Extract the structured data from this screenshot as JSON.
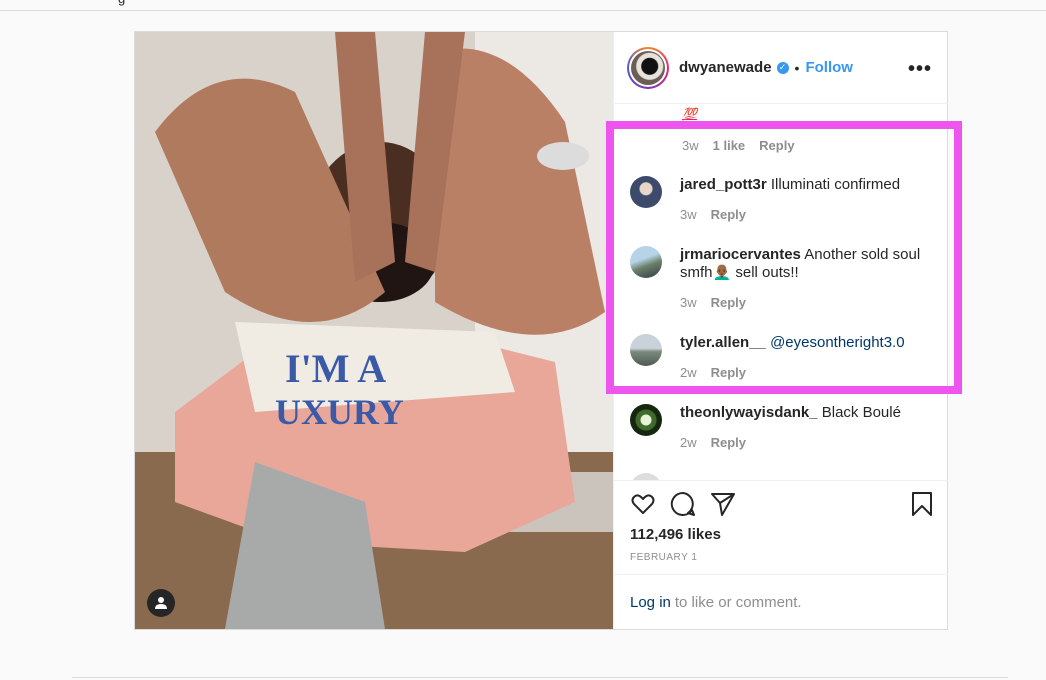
{
  "top_fragment": "g",
  "post": {
    "username": "dwyanewade",
    "verified_mark": "✓",
    "separator": "•",
    "follow_label": "Follow",
    "more_label": "•••",
    "emoji_line": "💯",
    "first_meta": {
      "time": "3w",
      "likes": "1 like",
      "reply": "Reply"
    },
    "comments": [
      {
        "user": "jared_pott3r",
        "text": "Illuminati confirmed",
        "time": "3w",
        "reply": "Reply"
      },
      {
        "user": "jrmariocervantes",
        "text": "Another sold soul smfh👨🏾‍🦲 sell outs!!",
        "time": "3w",
        "reply": "Reply"
      },
      {
        "user": "tyler.allen__",
        "text": "@eyesontheright3.0",
        "time": "2w",
        "reply": "Reply"
      },
      {
        "user": "theonlywayisdank_",
        "text": "Black Boulé",
        "time": "2w",
        "reply": "Reply"
      }
    ],
    "likes_count": "112,496 likes",
    "date": "FEBRUARY 1",
    "login_link": "Log in",
    "login_text": "to like or comment."
  },
  "icons": {
    "like": "heart-icon",
    "comment": "comment-icon",
    "share": "paper-plane-icon",
    "save": "bookmark-icon",
    "user_tag": "person-icon"
  },
  "colors": {
    "accent": "#3897f0",
    "highlight_box": "#ee55ee",
    "meta_text": "#8e8e8e",
    "link": "#00376b"
  }
}
